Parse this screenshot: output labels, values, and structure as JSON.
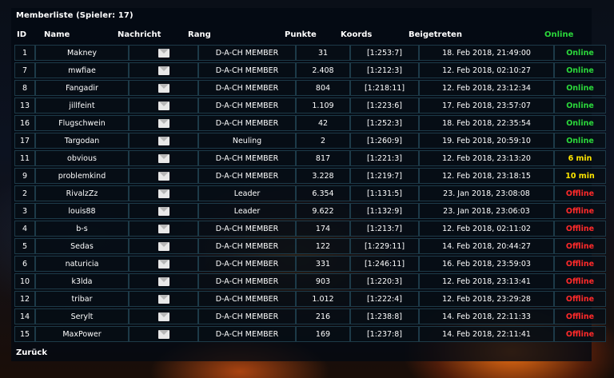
{
  "title": "Memberliste (Spieler: 17)",
  "columns": {
    "id": "ID",
    "name": "Name",
    "message": "Nachricht",
    "rank": "Rang",
    "points": "Punkte",
    "coords": "Koords",
    "joined": "Beigetreten",
    "online": "Online"
  },
  "status_colors": {
    "Online": "#2bd83b",
    "6 min": "#ffe600",
    "10 min": "#ffe600",
    "Offline": "#ff2a2a"
  },
  "members": [
    {
      "id": "1",
      "name": "Makney",
      "rank": "D-A-CH MEMBER",
      "points": "31",
      "coords": "[1:253:7]",
      "joined": "18. Feb 2018, 21:49:00",
      "status": "Online"
    },
    {
      "id": "7",
      "name": "mwfiae",
      "rank": "D-A-CH MEMBER",
      "points": "2.408",
      "coords": "[1:212:3]",
      "joined": "12. Feb 2018, 02:10:27",
      "status": "Online"
    },
    {
      "id": "8",
      "name": "Fangadir",
      "rank": "D-A-CH MEMBER",
      "points": "804",
      "coords": "[1:218:11]",
      "joined": "12. Feb 2018, 23:12:34",
      "status": "Online"
    },
    {
      "id": "13",
      "name": "jillfeint",
      "rank": "D-A-CH MEMBER",
      "points": "1.109",
      "coords": "[1:223:6]",
      "joined": "17. Feb 2018, 23:57:07",
      "status": "Online"
    },
    {
      "id": "16",
      "name": "Flugschwein",
      "rank": "D-A-CH MEMBER",
      "points": "42",
      "coords": "[1:252:3]",
      "joined": "18. Feb 2018, 22:35:54",
      "status": "Online"
    },
    {
      "id": "17",
      "name": "Targodan",
      "rank": "Neuling",
      "points": "2",
      "coords": "[1:260:9]",
      "joined": "19. Feb 2018, 20:59:10",
      "status": "Online"
    },
    {
      "id": "11",
      "name": "obvious",
      "rank": "D-A-CH MEMBER",
      "points": "817",
      "coords": "[1:221:3]",
      "joined": "12. Feb 2018, 23:13:20",
      "status": "6 min"
    },
    {
      "id": "9",
      "name": "problemkind",
      "rank": "D-A-CH MEMBER",
      "points": "3.228",
      "coords": "[1:219:7]",
      "joined": "12. Feb 2018, 23:18:15",
      "status": "10 min"
    },
    {
      "id": "2",
      "name": "RivalzZz",
      "rank": "Leader",
      "points": "6.354",
      "coords": "[1:131:5]",
      "joined": "23. Jan 2018, 23:08:08",
      "status": "Offline"
    },
    {
      "id": "3",
      "name": "louis88",
      "rank": "Leader",
      "points": "9.622",
      "coords": "[1:132:9]",
      "joined": "23. Jan 2018, 23:06:03",
      "status": "Offline"
    },
    {
      "id": "4",
      "name": "b-s",
      "rank": "D-A-CH MEMBER",
      "points": "174",
      "coords": "[1:213:7]",
      "joined": "12. Feb 2018, 02:11:02",
      "status": "Offline"
    },
    {
      "id": "5",
      "name": "Sedas",
      "rank": "D-A-CH MEMBER",
      "points": "122",
      "coords": "[1:229:11]",
      "joined": "14. Feb 2018, 20:44:27",
      "status": "Offline"
    },
    {
      "id": "6",
      "name": "naturicia",
      "rank": "D-A-CH MEMBER",
      "points": "331",
      "coords": "[1:246:11]",
      "joined": "16. Feb 2018, 23:59:03",
      "status": "Offline"
    },
    {
      "id": "10",
      "name": "k3lda",
      "rank": "D-A-CH MEMBER",
      "points": "903",
      "coords": "[1:220:3]",
      "joined": "12. Feb 2018, 23:13:41",
      "status": "Offline"
    },
    {
      "id": "12",
      "name": "tribar",
      "rank": "D-A-CH MEMBER",
      "points": "1.012",
      "coords": "[1:222:4]",
      "joined": "12. Feb 2018, 23:29:28",
      "status": "Offline"
    },
    {
      "id": "14",
      "name": "Serylt",
      "rank": "D-A-CH MEMBER",
      "points": "216",
      "coords": "[1:238:8]",
      "joined": "14. Feb 2018, 22:11:33",
      "status": "Offline"
    },
    {
      "id": "15",
      "name": "MaxPower",
      "rank": "D-A-CH MEMBER",
      "points": "169",
      "coords": "[1:237:8]",
      "joined": "14. Feb 2018, 22:11:41",
      "status": "Offline"
    }
  ],
  "footer": {
    "back_label": "Zurück"
  }
}
